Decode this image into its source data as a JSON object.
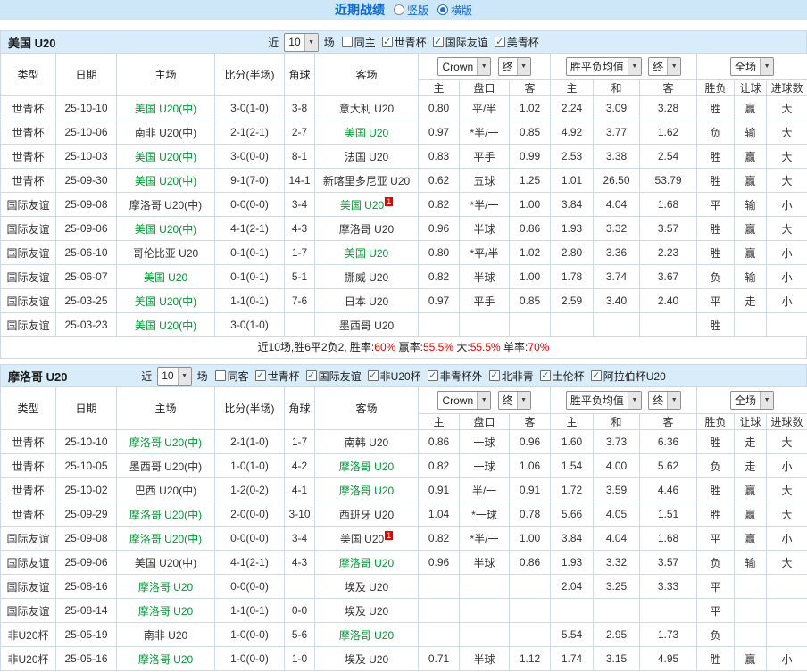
{
  "icons": {
    "chevron_down": "▼",
    "check": "✓"
  },
  "colors": {
    "red": "#e60000",
    "green": "#009933",
    "blue": "#0a6cd6",
    "type_green": "#55a055",
    "type_blue": "#5b7bd5",
    "type_teal": "#2f9599",
    "featured": "#009933",
    "score": "#e60000",
    "title": "#0a6cd6",
    "topbar_bg": "#cde7f8",
    "bar_bg": "#d9ecfa",
    "border": "#cdd9e6"
  },
  "topbar": {
    "title": "近期战绩",
    "radio_vertical": "竖版",
    "radio_horizontal": "横版"
  },
  "sections": [
    {
      "team": "美国 U20",
      "filter": {
        "near_label": "近",
        "count": "10",
        "games_label": "场",
        "checkboxes": [
          {
            "label": "同主",
            "checked": false
          },
          {
            "label": "世青杯",
            "checked": true
          },
          {
            "label": "国际友谊",
            "checked": true
          },
          {
            "label": "美青杯",
            "checked": true
          }
        ]
      },
      "header": {
        "type": "类型",
        "date": "日期",
        "home": "主场",
        "score": "比分(半场)",
        "corner": "角球",
        "away": "客场",
        "book": "Crown",
        "book_final": "终",
        "avg": "胜平负均值",
        "avg_final": "终",
        "full": "全场",
        "sub": [
          "主",
          "盘口",
          "客",
          "主",
          "和",
          "客",
          "胜负",
          "让球",
          "进球数"
        ]
      },
      "rows": [
        {
          "type": "世青杯",
          "type_class": "t-green",
          "date": "25-10-10",
          "home": "美国 U20(中)",
          "home_featured": true,
          "home_redcard": "",
          "score": "3-0(1-0)",
          "corner": "3-8",
          "away": "意大利 U20",
          "away_featured": false,
          "away_redcard": "",
          "odds": [
            "0.80",
            "平/半",
            "1.02"
          ],
          "avg": [
            "2.24",
            "3.09",
            "3.28"
          ],
          "result": {
            "text": "胜",
            "cls": "c-red"
          },
          "let": {
            "text": "赢",
            "cls": "c-red"
          },
          "goals": {
            "text": "大",
            "cls": "c-red"
          }
        },
        {
          "type": "世青杯",
          "type_class": "t-green",
          "date": "25-10-06",
          "home": "南非 U20(中)",
          "home_featured": false,
          "home_redcard": "",
          "score": "2-1(2-1)",
          "corner": "2-7",
          "away": "美国 U20",
          "away_featured": true,
          "away_redcard": "",
          "odds": [
            "0.97",
            "*半/一",
            "0.85"
          ],
          "avg": [
            "4.92",
            "3.77",
            "1.62"
          ],
          "result": {
            "text": "负",
            "cls": "c-green"
          },
          "let": {
            "text": "输",
            "cls": "c-green"
          },
          "goals": {
            "text": "大",
            "cls": "c-red"
          }
        },
        {
          "type": "世青杯",
          "type_class": "t-green",
          "date": "25-10-03",
          "home": "美国 U20(中)",
          "home_featured": true,
          "home_redcard": "",
          "score": "3-0(0-0)",
          "corner": "8-1",
          "away": "法国 U20",
          "away_featured": false,
          "away_redcard": "",
          "odds": [
            "0.83",
            "平手",
            "0.99"
          ],
          "avg": [
            "2.53",
            "3.38",
            "2.54"
          ],
          "result": {
            "text": "胜",
            "cls": "c-red"
          },
          "let": {
            "text": "赢",
            "cls": "c-red"
          },
          "goals": {
            "text": "大",
            "cls": "c-red"
          }
        },
        {
          "type": "世青杯",
          "type_class": "t-green",
          "date": "25-09-30",
          "home": "美国 U20(中)",
          "home_featured": true,
          "home_redcard": "",
          "score": "9-1(7-0)",
          "corner": "14-1",
          "away": "新喀里多尼亚 U20",
          "away_featured": false,
          "away_redcard": "",
          "odds": [
            "0.62",
            "五球",
            "1.25"
          ],
          "avg": [
            "1.01",
            "26.50",
            "53.79"
          ],
          "result": {
            "text": "胜",
            "cls": "c-red"
          },
          "let": {
            "text": "赢",
            "cls": "c-red"
          },
          "goals": {
            "text": "大",
            "cls": "c-red"
          }
        },
        {
          "type": "国际友谊",
          "type_class": "t-blue",
          "date": "25-09-08",
          "home": "摩洛哥 U20(中)",
          "home_featured": false,
          "home_redcard": "",
          "score": "0-0(0-0)",
          "corner": "3-4",
          "away": "美国 U20",
          "away_featured": true,
          "away_redcard": "1",
          "odds": [
            "0.82",
            "*半/一",
            "1.00"
          ],
          "avg": [
            "3.84",
            "4.04",
            "1.68"
          ],
          "result": {
            "text": "平",
            "cls": "c-blue"
          },
          "let": {
            "text": "输",
            "cls": "c-green"
          },
          "goals": {
            "text": "小",
            "cls": "c-green"
          }
        },
        {
          "type": "国际友谊",
          "type_class": "t-blue",
          "date": "25-09-06",
          "home": "美国 U20(中)",
          "home_featured": true,
          "home_redcard": "",
          "score": "4-1(2-1)",
          "corner": "4-3",
          "away": "摩洛哥 U20",
          "away_featured": false,
          "away_redcard": "",
          "odds": [
            "0.96",
            "半球",
            "0.86"
          ],
          "avg": [
            "1.93",
            "3.32",
            "3.57"
          ],
          "result": {
            "text": "胜",
            "cls": "c-red"
          },
          "let": {
            "text": "赢",
            "cls": "c-red"
          },
          "goals": {
            "text": "大",
            "cls": "c-red"
          }
        },
        {
          "type": "国际友谊",
          "type_class": "t-blue",
          "date": "25-06-10",
          "home": "哥伦比亚 U20",
          "home_featured": false,
          "home_redcard": "",
          "score": "0-1(0-1)",
          "corner": "1-7",
          "away": "美国 U20",
          "away_featured": true,
          "away_redcard": "",
          "odds": [
            "0.80",
            "*平/半",
            "1.02"
          ],
          "avg": [
            "2.80",
            "3.36",
            "2.23"
          ],
          "result": {
            "text": "胜",
            "cls": "c-red"
          },
          "let": {
            "text": "赢",
            "cls": "c-red"
          },
          "goals": {
            "text": "小",
            "cls": "c-green"
          }
        },
        {
          "type": "国际友谊",
          "type_class": "t-blue",
          "date": "25-06-07",
          "home": "美国 U20",
          "home_featured": true,
          "home_redcard": "",
          "score": "0-1(0-1)",
          "corner": "5-1",
          "away": "挪威 U20",
          "away_featured": false,
          "away_redcard": "",
          "odds": [
            "0.82",
            "半球",
            "1.00"
          ],
          "avg": [
            "1.78",
            "3.74",
            "3.67"
          ],
          "result": {
            "text": "负",
            "cls": "c-green"
          },
          "let": {
            "text": "输",
            "cls": "c-green"
          },
          "goals": {
            "text": "小",
            "cls": "c-green"
          }
        },
        {
          "type": "国际友谊",
          "type_class": "t-blue",
          "date": "25-03-25",
          "home": "美国 U20(中)",
          "home_featured": true,
          "home_redcard": "",
          "score": "1-1(0-1)",
          "corner": "7-6",
          "away": "日本 U20",
          "away_featured": false,
          "away_redcard": "",
          "odds": [
            "0.97",
            "平手",
            "0.85"
          ],
          "avg": [
            "2.59",
            "3.40",
            "2.40"
          ],
          "result": {
            "text": "平",
            "cls": "c-blue"
          },
          "let": {
            "text": "走",
            "cls": "c-blue"
          },
          "goals": {
            "text": "小",
            "cls": "c-green"
          }
        },
        {
          "type": "国际友谊",
          "type_class": "t-blue",
          "date": "25-03-23",
          "home": "美国 U20(中)",
          "home_featured": true,
          "home_redcard": "",
          "score": "3-0(1-0)",
          "corner": "",
          "away": "墨西哥 U20",
          "away_featured": false,
          "away_redcard": "",
          "odds": [
            "",
            "",
            ""
          ],
          "avg": [
            "",
            "",
            ""
          ],
          "result": {
            "text": "胜",
            "cls": "c-red"
          },
          "let": {
            "text": "",
            "cls": ""
          },
          "goals": {
            "text": "",
            "cls": ""
          }
        }
      ],
      "summary": [
        {
          "text": "近10场,胜6平2负2, 胜率:",
          "cls": ""
        },
        {
          "text": "60%",
          "cls": "c-red"
        },
        {
          "text": " 赢率:",
          "cls": ""
        },
        {
          "text": "55.5%",
          "cls": "c-red"
        },
        {
          "text": " 大:",
          "cls": ""
        },
        {
          "text": "55.5%",
          "cls": "c-red"
        },
        {
          "text": " 单率:",
          "cls": ""
        },
        {
          "text": "70%",
          "cls": "c-red"
        }
      ]
    },
    {
      "team": "摩洛哥 U20",
      "filter": {
        "near_label": "近",
        "count": "10",
        "games_label": "场",
        "checkboxes": [
          {
            "label": "同客",
            "checked": false
          },
          {
            "label": "世青杯",
            "checked": true
          },
          {
            "label": "国际友谊",
            "checked": true
          },
          {
            "label": "非U20杯",
            "checked": true
          },
          {
            "label": "非青杯外",
            "checked": true
          },
          {
            "label": "北非青",
            "checked": true
          },
          {
            "label": "土伦杯",
            "checked": true
          },
          {
            "label": "阿拉伯杯U20",
            "checked": true
          }
        ]
      },
      "header": {
        "type": "类型",
        "date": "日期",
        "home": "主场",
        "score": "比分(半场)",
        "corner": "角球",
        "away": "客场",
        "book": "Crown",
        "book_final": "终",
        "avg": "胜平负均值",
        "avg_final": "终",
        "full": "全场",
        "sub": [
          "主",
          "盘口",
          "客",
          "主",
          "和",
          "客",
          "胜负",
          "让球",
          "进球数"
        ]
      },
      "rows": [
        {
          "type": "世青杯",
          "type_class": "t-green",
          "date": "25-10-10",
          "home": "摩洛哥 U20(中)",
          "home_featured": true,
          "home_redcard": "",
          "score": "2-1(1-0)",
          "corner": "1-7",
          "away": "南韩 U20",
          "away_featured": false,
          "away_redcard": "",
          "odds": [
            "0.86",
            "一球",
            "0.96"
          ],
          "avg": [
            "1.60",
            "3.73",
            "6.36"
          ],
          "result": {
            "text": "胜",
            "cls": "c-red"
          },
          "let": {
            "text": "走",
            "cls": "c-blue"
          },
          "goals": {
            "text": "大",
            "cls": "c-red"
          }
        },
        {
          "type": "世青杯",
          "type_class": "t-green",
          "date": "25-10-05",
          "home": "墨西哥 U20(中)",
          "home_featured": false,
          "home_redcard": "",
          "score": "1-0(1-0)",
          "corner": "4-2",
          "away": "摩洛哥 U20",
          "away_featured": true,
          "away_redcard": "",
          "odds": [
            "0.82",
            "一球",
            "1.06"
          ],
          "avg": [
            "1.54",
            "4.00",
            "5.62"
          ],
          "result": {
            "text": "负",
            "cls": "c-green"
          },
          "let": {
            "text": "走",
            "cls": "c-blue"
          },
          "goals": {
            "text": "小",
            "cls": "c-green"
          }
        },
        {
          "type": "世青杯",
          "type_class": "t-green",
          "date": "25-10-02",
          "home": "巴西 U20(中)",
          "home_featured": false,
          "home_redcard": "",
          "score": "1-2(0-2)",
          "corner": "4-1",
          "away": "摩洛哥 U20",
          "away_featured": true,
          "away_redcard": "",
          "odds": [
            "0.91",
            "半/一",
            "0.91"
          ],
          "avg": [
            "1.72",
            "3.59",
            "4.46"
          ],
          "result": {
            "text": "胜",
            "cls": "c-red"
          },
          "let": {
            "text": "赢",
            "cls": "c-red"
          },
          "goals": {
            "text": "大",
            "cls": "c-red"
          }
        },
        {
          "type": "世青杯",
          "type_class": "t-green",
          "date": "25-09-29",
          "home": "摩洛哥 U20(中)",
          "home_featured": true,
          "home_redcard": "",
          "score": "2-0(0-0)",
          "corner": "3-10",
          "away": "西班牙 U20",
          "away_featured": false,
          "away_redcard": "",
          "odds": [
            "1.04",
            "*一球",
            "0.78"
          ],
          "avg": [
            "5.66",
            "4.05",
            "1.51"
          ],
          "result": {
            "text": "胜",
            "cls": "c-red"
          },
          "let": {
            "text": "赢",
            "cls": "c-red"
          },
          "goals": {
            "text": "大",
            "cls": "c-red"
          }
        },
        {
          "type": "国际友谊",
          "type_class": "t-blue",
          "date": "25-09-08",
          "home": "摩洛哥 U20(中)",
          "home_featured": true,
          "home_redcard": "",
          "score": "0-0(0-0)",
          "corner": "3-4",
          "away": "美国 U20",
          "away_featured": false,
          "away_redcard": "1",
          "odds": [
            "0.82",
            "*半/一",
            "1.00"
          ],
          "avg": [
            "3.84",
            "4.04",
            "1.68"
          ],
          "result": {
            "text": "平",
            "cls": "c-blue"
          },
          "let": {
            "text": "赢",
            "cls": "c-red"
          },
          "goals": {
            "text": "小",
            "cls": "c-green"
          }
        },
        {
          "type": "国际友谊",
          "type_class": "t-blue",
          "date": "25-09-06",
          "home": "美国 U20(中)",
          "home_featured": false,
          "home_redcard": "",
          "score": "4-1(2-1)",
          "corner": "4-3",
          "away": "摩洛哥 U20",
          "away_featured": true,
          "away_redcard": "",
          "odds": [
            "0.96",
            "半球",
            "0.86"
          ],
          "avg": [
            "1.93",
            "3.32",
            "3.57"
          ],
          "result": {
            "text": "负",
            "cls": "c-green"
          },
          "let": {
            "text": "输",
            "cls": "c-green"
          },
          "goals": {
            "text": "大",
            "cls": "c-red"
          }
        },
        {
          "type": "国际友谊",
          "type_class": "t-blue",
          "date": "25-08-16",
          "home": "摩洛哥 U20",
          "home_featured": true,
          "home_redcard": "",
          "score": "0-0(0-0)",
          "corner": "",
          "away": "埃及 U20",
          "away_featured": false,
          "away_redcard": "",
          "odds": [
            "",
            "",
            ""
          ],
          "avg": [
            "2.04",
            "3.25",
            "3.33"
          ],
          "result": {
            "text": "平",
            "cls": "c-blue"
          },
          "let": {
            "text": "",
            "cls": ""
          },
          "goals": {
            "text": "",
            "cls": ""
          }
        },
        {
          "type": "国际友谊",
          "type_class": "t-blue",
          "date": "25-08-14",
          "home": "摩洛哥 U20",
          "home_featured": true,
          "home_redcard": "",
          "score": "1-1(0-1)",
          "corner": "0-0",
          "away": "埃及 U20",
          "away_featured": false,
          "away_redcard": "",
          "odds": [
            "",
            "",
            ""
          ],
          "avg": [
            "",
            "",
            ""
          ],
          "result": {
            "text": "平",
            "cls": "c-blue"
          },
          "let": {
            "text": "",
            "cls": ""
          },
          "goals": {
            "text": "",
            "cls": ""
          }
        },
        {
          "type": "非U20杯",
          "type_class": "t-teal",
          "date": "25-05-19",
          "home": "南非 U20",
          "home_featured": false,
          "home_redcard": "",
          "score": "1-0(0-0)",
          "corner": "5-6",
          "away": "摩洛哥 U20",
          "away_featured": true,
          "away_redcard": "",
          "odds": [
            "",
            "",
            ""
          ],
          "avg": [
            "5.54",
            "2.95",
            "1.73"
          ],
          "result": {
            "text": "负",
            "cls": "c-green"
          },
          "let": {
            "text": "",
            "cls": ""
          },
          "goals": {
            "text": "",
            "cls": ""
          }
        },
        {
          "type": "非U20杯",
          "type_class": "t-teal",
          "date": "25-05-16",
          "home": "摩洛哥 U20",
          "home_featured": true,
          "home_redcard": "",
          "score": "1-0(0-0)",
          "corner": "1-0",
          "away": "埃及 U20",
          "away_featured": false,
          "away_redcard": "",
          "odds": [
            "0.71",
            "半球",
            "1.12"
          ],
          "avg": [
            "1.74",
            "3.15",
            "4.95"
          ],
          "result": {
            "text": "胜",
            "cls": "c-red"
          },
          "let": {
            "text": "赢",
            "cls": "c-red"
          },
          "goals": {
            "text": "小",
            "cls": "c-green"
          }
        }
      ],
      "summary": []
    }
  ]
}
